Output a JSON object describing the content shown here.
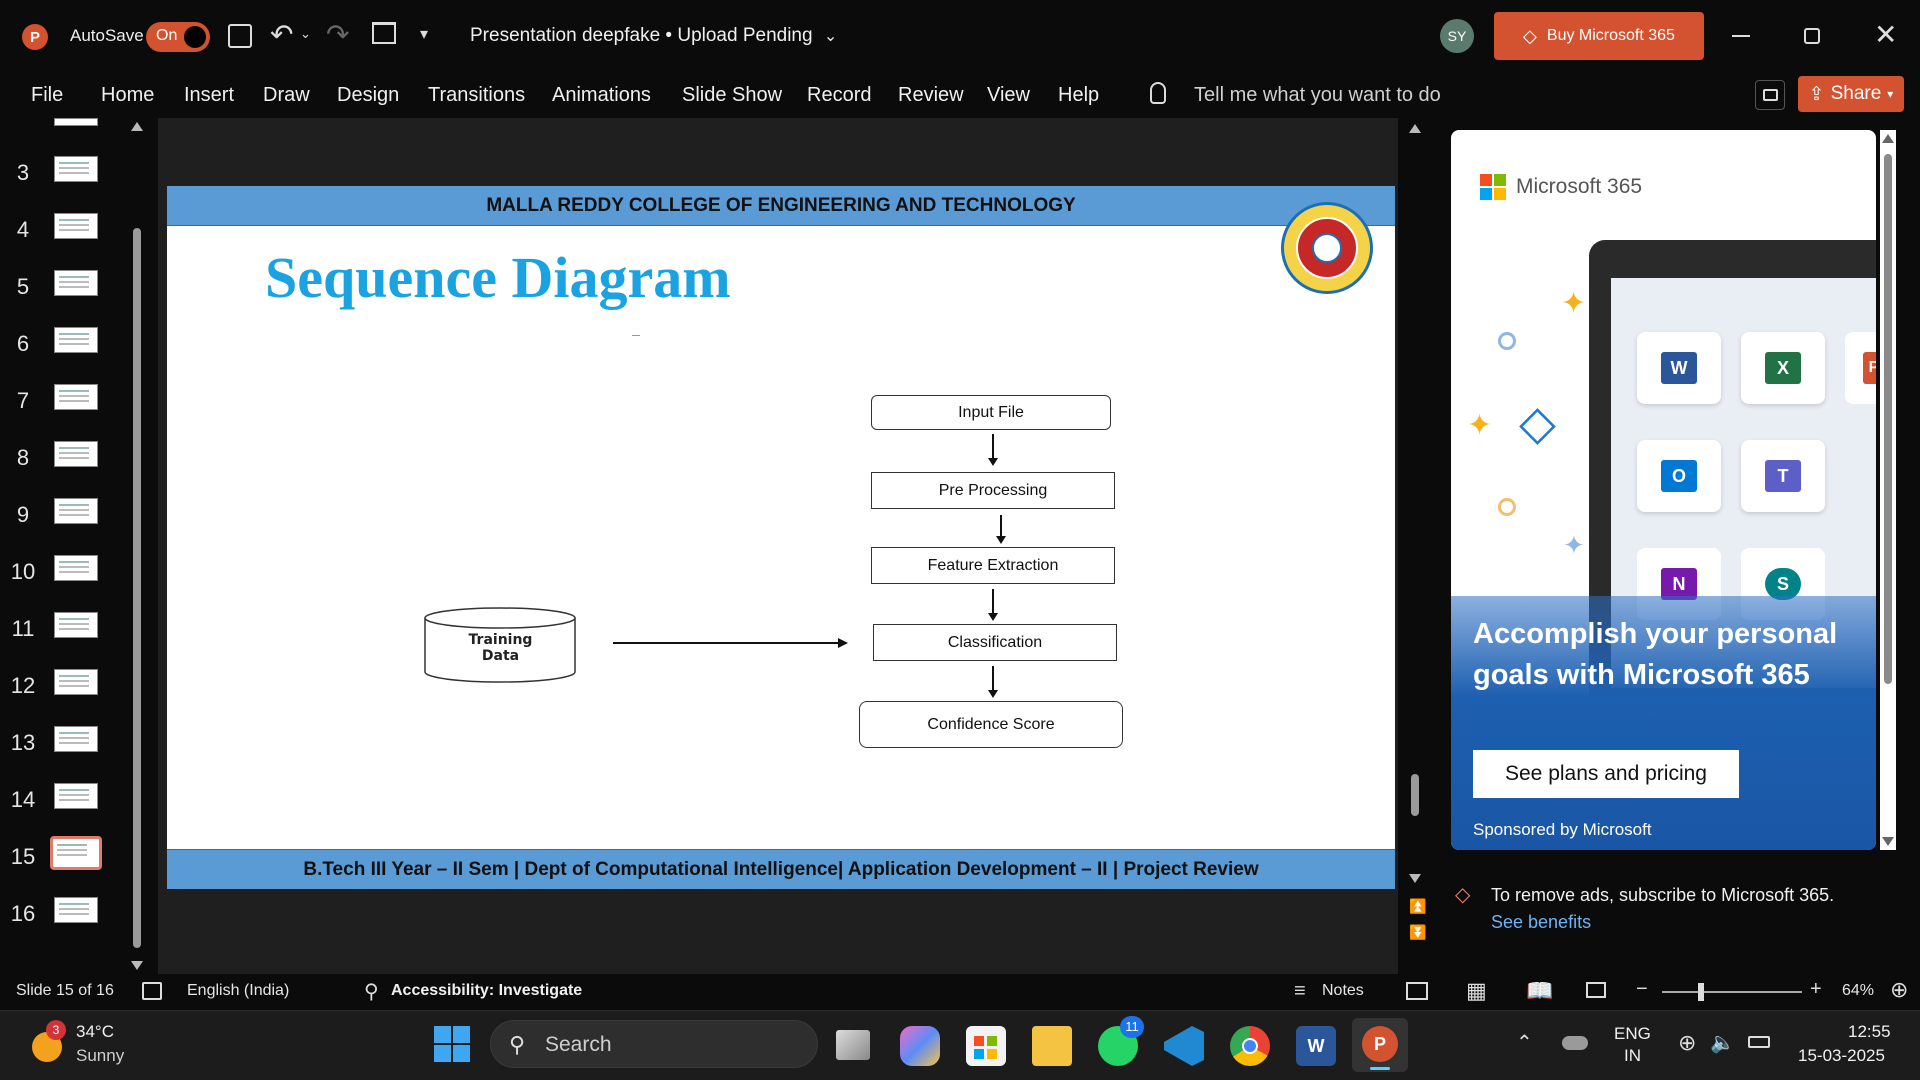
{
  "titlebar": {
    "app_icon": "powerpoint-icon",
    "autosave_label": "AutoSave",
    "autosave_state": "On",
    "document_title": "Presentation deepfake • Upload Pending",
    "user_initials": "SY",
    "buy_button": "Buy Microsoft 365",
    "accent_color": "#d35230"
  },
  "ribbon": {
    "menu": [
      "File",
      "Home",
      "Insert",
      "Draw",
      "Design",
      "Transitions",
      "Animations",
      "Slide Show",
      "Record",
      "Review",
      "View",
      "Help"
    ],
    "tell_me": "Tell me what you want to do",
    "share": "Share"
  },
  "thumbnails": {
    "numbers": [
      "3",
      "4",
      "5",
      "6",
      "7",
      "8",
      "9",
      "10",
      "11",
      "12",
      "13",
      "14",
      "15",
      "16"
    ],
    "selected": "15"
  },
  "slide": {
    "header": "MALLA REDDY COLLEGE OF ENGINEERING AND TECHNOLOGY",
    "title": "Sequence Diagram",
    "footer": "B.Tech III Year – II Sem | Dept of Computational Intelligence| Application Development – II | Project Review",
    "band_color": "#5b9bd5",
    "title_color": "#1aa3e0",
    "diagram": {
      "training_data": "Training Data",
      "steps": [
        "Input File",
        "Pre Processing",
        "Feature Extraction",
        "Classification",
        "Confidence Score"
      ]
    }
  },
  "ad": {
    "brand": "Microsoft 365",
    "headline": "Accomplish your personal goals with Microsoft 365",
    "cta": "See plans and pricing",
    "sponsor": "Sponsored by Microsoft",
    "remove_text": "To remove ads, subscribe to Microsoft 365.",
    "benefits_link": "See benefits"
  },
  "status": {
    "slide_count": "Slide 15 of 16",
    "language": "English (India)",
    "accessibility": "Accessibility: Investigate",
    "notes": "Notes",
    "zoom": "64%"
  },
  "taskbar": {
    "weather_temp": "34°C",
    "weather_desc": "Sunny",
    "weather_badge": "3",
    "search": "Search",
    "whatsapp_badge": "11",
    "lang_top": "ENG",
    "lang_bottom": "IN",
    "time": "12:55",
    "date": "15-03-2025"
  }
}
